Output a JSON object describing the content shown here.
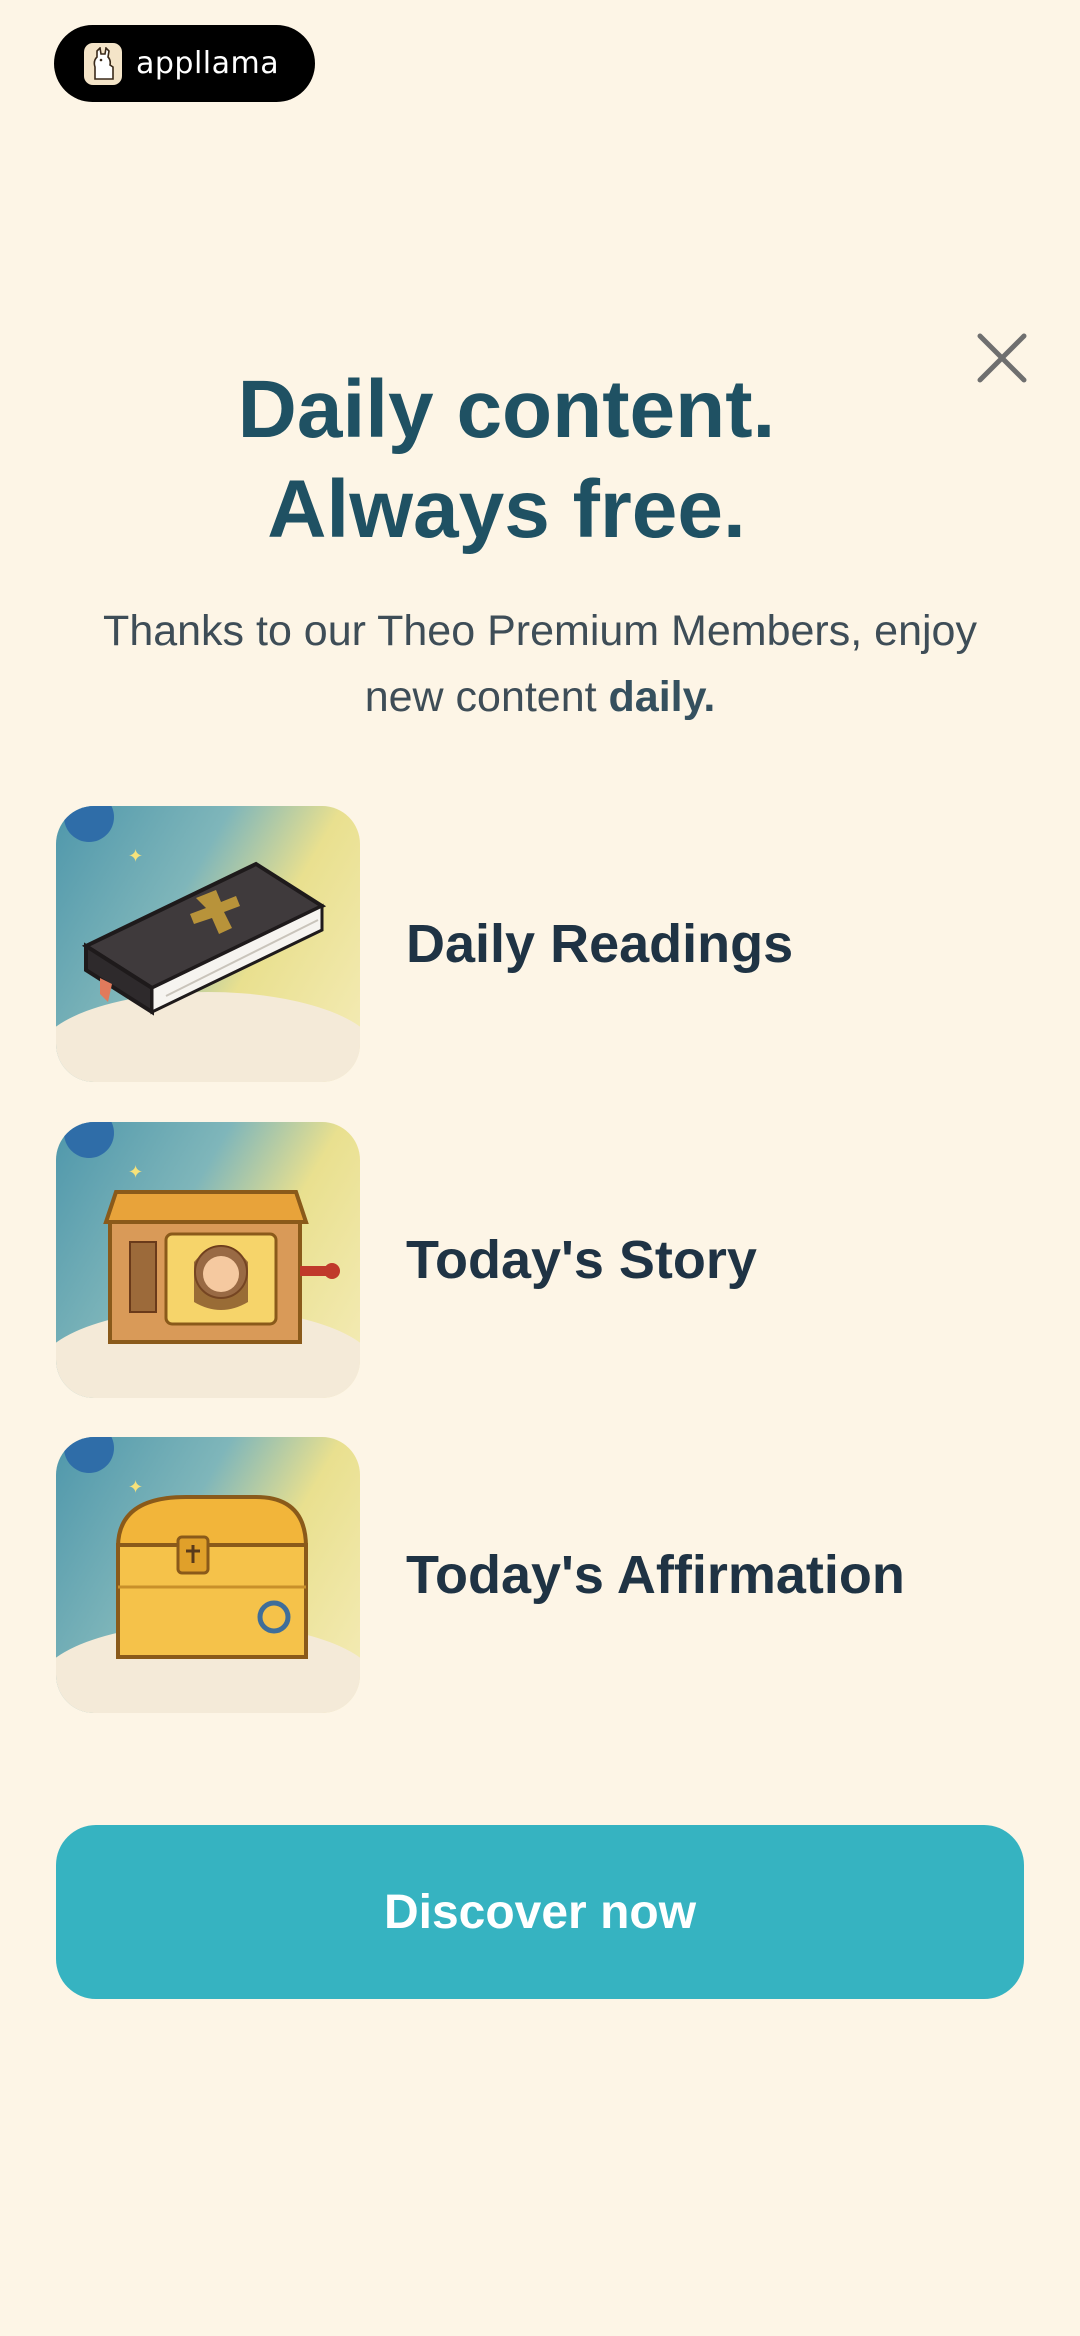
{
  "watermark": {
    "brand": "appllama"
  },
  "modal": {
    "headline_line1": "Daily content.",
    "headline_line2": "Always free.",
    "subtitle_prefix": "Thanks to our Theo Premium Members, enjoy new content ",
    "subtitle_bold": "daily.",
    "close_icon": "close-icon"
  },
  "features": [
    {
      "label": "Daily Readings",
      "icon": "bible-icon"
    },
    {
      "label": "Today's Story",
      "icon": "story-box-icon"
    },
    {
      "label": "Today's Affirmation",
      "icon": "treasure-chest-icon"
    }
  ],
  "cta": {
    "label": "Discover now",
    "color": "#36b3c1"
  },
  "colors": {
    "background": "#fdf5e6",
    "headline": "#1f5163",
    "text": "#3e4d57"
  }
}
